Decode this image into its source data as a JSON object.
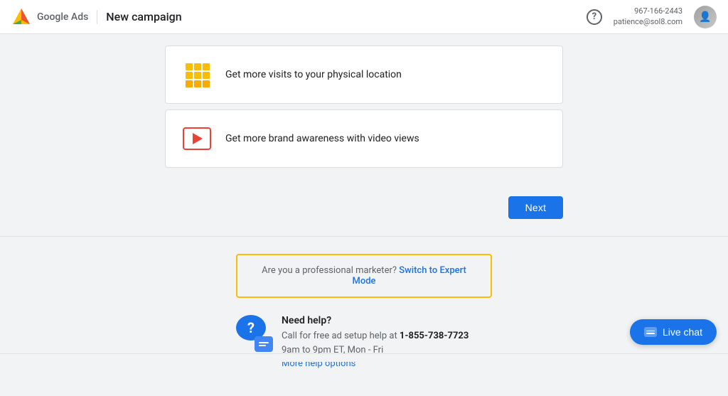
{
  "header": {
    "logo_text": "Google Ads",
    "divider": "|",
    "campaign_title": "New campaign",
    "help_label": "?",
    "user_phone": "967-166-2443",
    "user_email": "patience@sol8.com"
  },
  "options": [
    {
      "id": "physical-location",
      "text": "Get more visits to your physical location",
      "icon_type": "building"
    },
    {
      "id": "video-views",
      "text": "Get more brand awareness with video views",
      "icon_type": "video"
    }
  ],
  "next_button": {
    "label": "Next"
  },
  "expert_banner": {
    "pre_text": "Are you a professional marketer?",
    "link_text": "Switch to Expert Mode"
  },
  "help_section": {
    "title": "Need help?",
    "description_pre": "Call for free ad setup help at ",
    "phone": "1-855-738-7723",
    "hours": "9am to 9pm ET, Mon - Fri",
    "more_link": "More help options"
  },
  "live_chat": {
    "label": "Live chat"
  }
}
